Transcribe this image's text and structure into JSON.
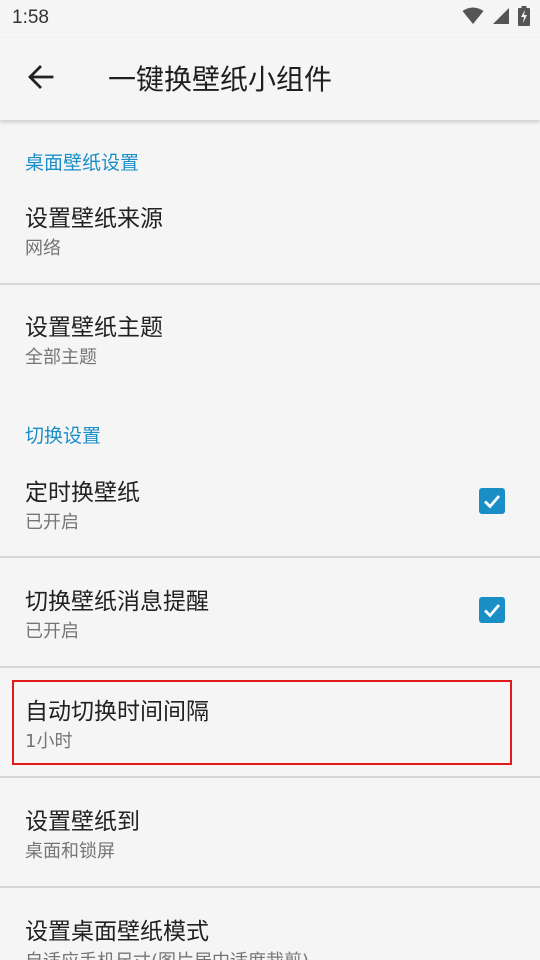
{
  "status_bar": {
    "time": "1:58",
    "icons": [
      "wifi-icon",
      "signal-icon",
      "battery-charging-icon"
    ]
  },
  "app_bar": {
    "back_icon": "arrow-back-icon",
    "title": "一键换壁纸小组件"
  },
  "sections": {
    "desktop": {
      "header": "桌面壁纸设置"
    },
    "switch": {
      "header": "切换设置"
    }
  },
  "prefs": {
    "wallpaper_source": {
      "title": "设置壁纸来源",
      "summary": "网络"
    },
    "wallpaper_theme": {
      "title": "设置壁纸主题",
      "summary": "全部主题"
    },
    "timed_change": {
      "title": "定时换壁纸",
      "summary": "已开启",
      "checked": true
    },
    "change_notification": {
      "title": "切换壁纸消息提醒",
      "summary": "已开启",
      "checked": true
    },
    "auto_interval": {
      "title": "自动切换时间间隔",
      "summary": "1小时",
      "highlighted": true
    },
    "set_wallpaper_to": {
      "title": "设置壁纸到",
      "summary": "桌面和锁屏"
    },
    "desktop_mode": {
      "title": "设置桌面壁纸模式",
      "summary": "自适应手机尺寸(图片居中适度裁剪)"
    }
  },
  "colors": {
    "accent": "#1a8fc7",
    "highlight": "#e01b1b",
    "background": "#f5f5f5"
  }
}
